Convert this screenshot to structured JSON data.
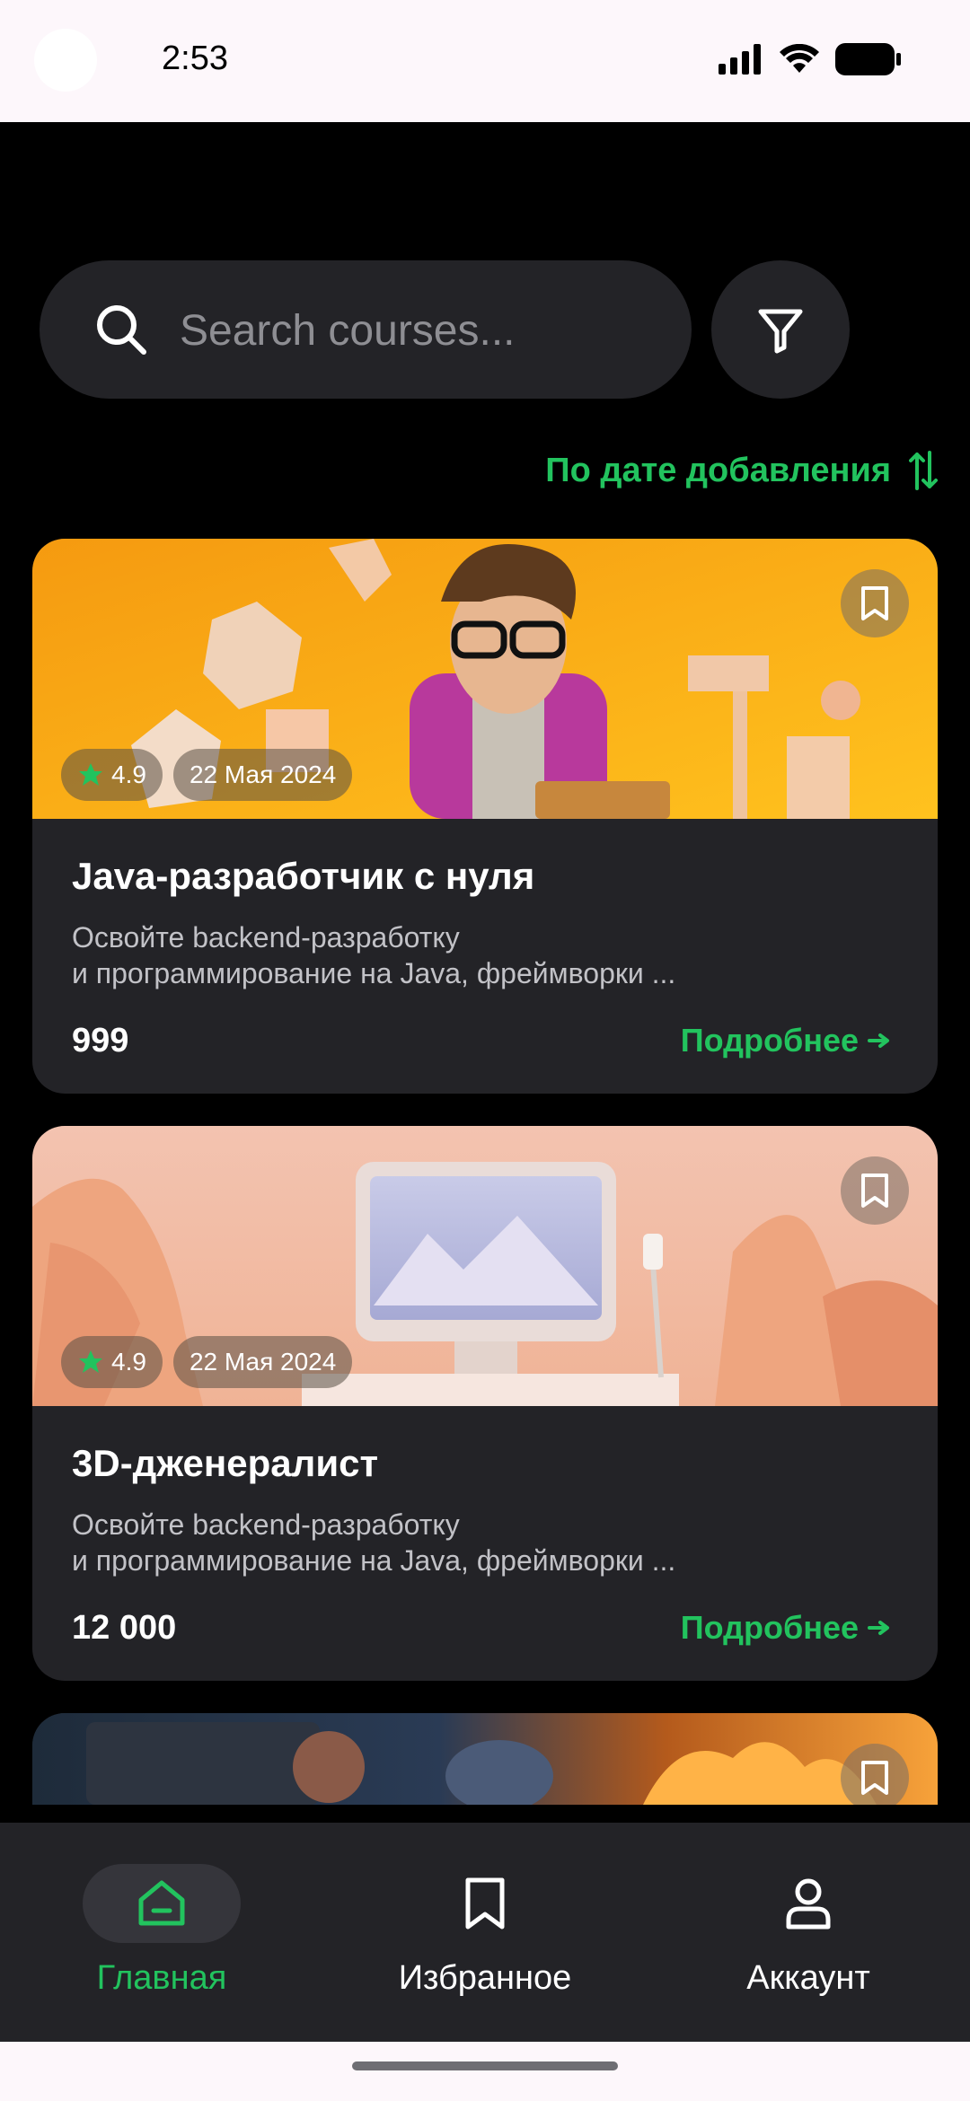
{
  "status_bar": {
    "time": "2:53"
  },
  "search": {
    "placeholder": "Search courses..."
  },
  "sort": {
    "label": "По дате добавления"
  },
  "courses": [
    {
      "title": "Java-разработчик с нуля",
      "description_line1": "Освойте backend-разработку",
      "description_line2": "и программирование на Java, фреймворки ...",
      "price": "999",
      "rating": "4.9",
      "date": "22 Мая 2024",
      "more_label": "Подробнее"
    },
    {
      "title": "3D-дженералист",
      "description_line1": "Освойте backend-разработку",
      "description_line2": "и программирование на Java, фреймворки ...",
      "price": "12 000",
      "rating": "4.9",
      "date": "22 Мая 2024",
      "more_label": "Подробнее"
    }
  ],
  "nav": {
    "items": [
      {
        "label": "Главная",
        "icon": "home-icon",
        "active": true
      },
      {
        "label": "Избранное",
        "icon": "bookmark-icon",
        "active": false
      },
      {
        "label": "Аккаунт",
        "icon": "user-icon",
        "active": false
      }
    ]
  },
  "colors": {
    "accent": "#22c35e",
    "card": "#232327",
    "background": "#000000"
  }
}
